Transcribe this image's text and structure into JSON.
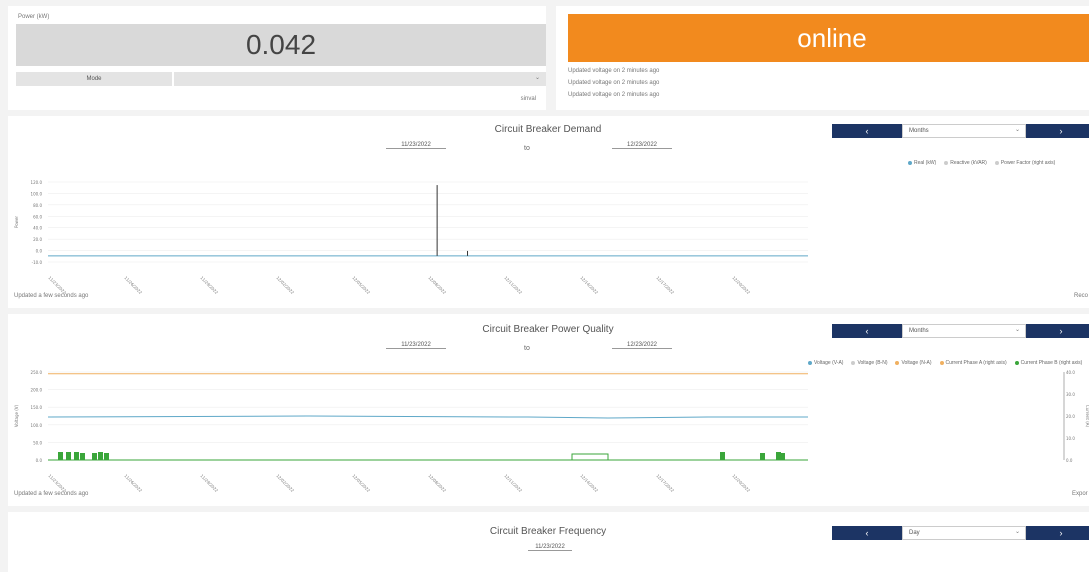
{
  "power_card": {
    "label": "Power (kW)",
    "value": "0.042",
    "mode_label": "Mode",
    "footer": "sinval"
  },
  "status_card": {
    "status": "online",
    "updates": [
      "Updated voltage on 2 minutes ago",
      "Updated voltage on 2 minutes ago",
      "Updated voltage on 2 minutes ago"
    ]
  },
  "colors": {
    "accent_orange": "#f28a1e",
    "nav_blue": "#1c3464",
    "series_teal": "#5fa8c8",
    "series_orange": "#f0b060",
    "series_green": "#3aa63a"
  },
  "panels": [
    {
      "title": "Circuit Breaker Demand",
      "date_from": "11/23/2022",
      "date_to": "12/23/2022",
      "to_label": "to",
      "period_option": "Months",
      "updated": "Updated a few seconds ago",
      "corner_label": "Reco",
      "legend": [
        "Real (kW)",
        "Reactive (kVAR)",
        "Power Factor (right axis)"
      ]
    },
    {
      "title": "Circuit Breaker Power Quality",
      "date_from": "11/23/2022",
      "date_to": "12/23/2022",
      "to_label": "to",
      "period_option": "Months",
      "updated": "Updated a few seconds ago",
      "corner_label": "Expor",
      "legend": [
        "Voltage (V-A)",
        "Voltage (B-N)",
        "Voltage (N-A)",
        "Current Phase A (right axis)",
        "Current Phase B (right axis)"
      ]
    },
    {
      "title": "Circuit Breaker Frequency",
      "date_from": "11/23/2022",
      "period_option": "Day"
    }
  ],
  "nav": {
    "prev": "‹",
    "next": "›"
  },
  "chart_data": [
    {
      "type": "line",
      "title": "Circuit Breaker Demand",
      "ylabel": "Power",
      "ylim": [
        -10,
        120
      ],
      "y_ticks": [
        "120.0",
        "100.0",
        "80.0",
        "60.0",
        "40.0",
        "20.0",
        "0.0",
        "-10.0"
      ],
      "x_ticks": [
        "11/23/2022",
        "11/26/2022",
        "11/29/2022",
        "12/02/2022",
        "12/05/2022",
        "12/08/2022",
        "12/11/2022",
        "12/14/2022",
        "12/17/2022",
        "12/20/2022"
      ],
      "series": [
        {
          "name": "Real (kW)",
          "spikes": [
            [
              5.12,
              115
            ],
            [
              5.52,
              8
            ]
          ]
        }
      ],
      "grid": true,
      "legend_position": "top-right"
    },
    {
      "type": "line",
      "title": "Circuit Breaker Power Quality",
      "ylabel": "Voltage (V)",
      "ylabel_right": "Current (A)",
      "ylim": [
        0,
        250
      ],
      "y_ticks": [
        "250.0",
        "200.0",
        "150.0",
        "100.0",
        "50.0",
        "0.0"
      ],
      "y2_ticks": [
        "40.0",
        "30.0",
        "20.0",
        "10.0",
        "0.0"
      ],
      "x_ticks": [
        "11/23/2022",
        "11/26/2022",
        "11/29/2022",
        "12/02/2022",
        "12/05/2022",
        "12/08/2022",
        "12/11/2022",
        "12/14/2022",
        "12/17/2022",
        "12/20/2022"
      ],
      "series": [
        {
          "name": "Voltage (N-A)",
          "level": 245
        },
        {
          "name": "Voltage (V-A)",
          "level": 122
        }
      ],
      "grid": true,
      "legend_position": "top-right"
    }
  ]
}
